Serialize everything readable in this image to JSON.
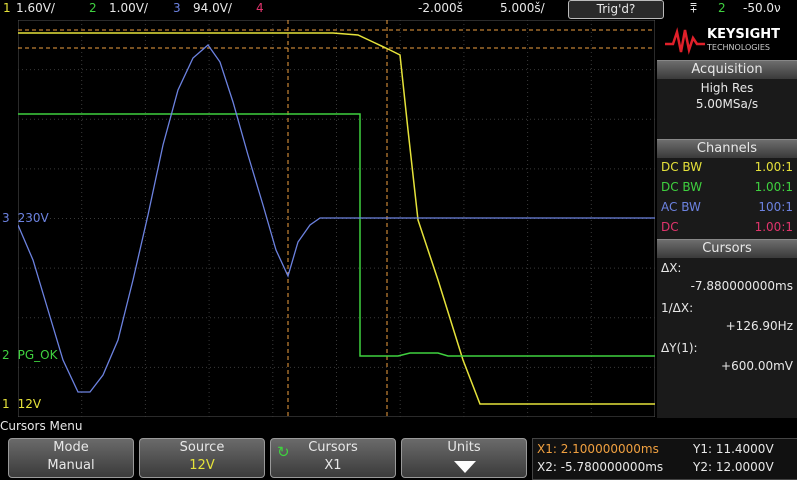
{
  "topbar": {
    "ch1": "1",
    "ch1_scale": "1.60V/",
    "ch2": "2",
    "ch2_scale": "1.00V/",
    "ch3": "3",
    "ch3_scale": "94.0V/",
    "ch4": "4",
    "time_offset": "-2.000š",
    "time_scale": "5.000š/",
    "trigger_status": "Trig'd?",
    "trig_icon": "⩱",
    "trig_channel": "2",
    "trig_level": "-50.0ν"
  },
  "colors": {
    "ch1": "#e5e23a",
    "ch2": "#3fd13f",
    "ch3": "#6c82e0",
    "ch4": "#e0346c",
    "cursor": "#f0a040"
  },
  "traces": {
    "ch3_label": "230V",
    "ch2_label": "PG_OK",
    "ch1_label": "12V",
    "ch3_marker": "3",
    "ch2_marker": "2",
    "ch1_marker": "1"
  },
  "panel": {
    "brand": "KEYSIGHT",
    "brand_sub": "TECHNOLOGIES",
    "acquisition_title": "Acquisition",
    "acq_mode": "High Res",
    "acq_rate": "5.00MSa/s",
    "channels_title": "Channels",
    "channels": [
      {
        "coupling": "DC BW",
        "ratio": "1.00:1"
      },
      {
        "coupling": "DC BW",
        "ratio": "1.00:1"
      },
      {
        "coupling": "AC BW",
        "ratio": "100:1"
      },
      {
        "coupling": "DC",
        "ratio": "1.00:1"
      }
    ],
    "cursors_title": "Cursors",
    "dx_label": "ΔX:",
    "dx_value": "-7.880000000ms",
    "inv_dx_label": "1/ΔX:",
    "inv_dx_value": "+126.90Hz",
    "dy_label": "ΔY(1):",
    "dy_value": "+600.00mV"
  },
  "menu": {
    "title": "Cursors Menu",
    "softkeys": [
      {
        "top": "Mode",
        "bottom": "Manual"
      },
      {
        "top": "Source",
        "bottom": "12V"
      },
      {
        "top": "Cursors",
        "bottom": "X1"
      },
      {
        "top": "Units",
        "bottom": ""
      }
    ]
  },
  "readout": {
    "x1": "X1: 2.100000000ms",
    "x2": "X2: -5.780000000ms",
    "y1": "Y1: 11.4000V",
    "y2": "Y2: 12.0000V"
  }
}
